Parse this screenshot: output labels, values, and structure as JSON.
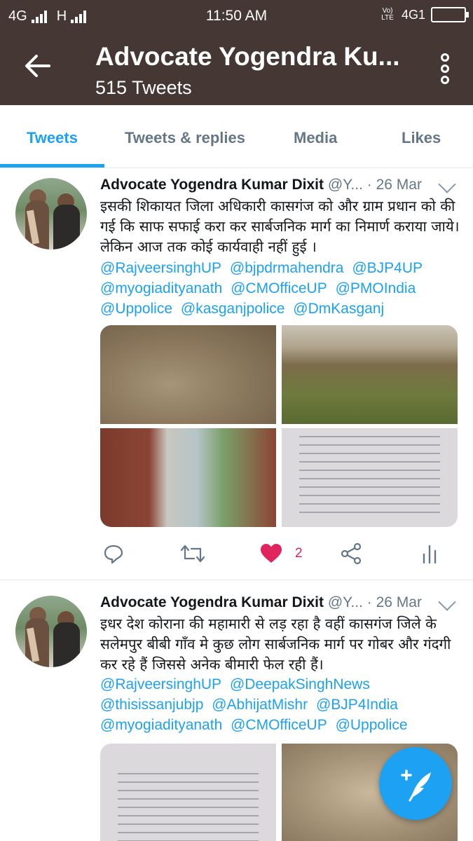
{
  "status_bar": {
    "network_left": "4G",
    "network_h": "H",
    "time": "11:50 AM",
    "volte": "Vo) LTE",
    "network_right": "4G1"
  },
  "app_bar": {
    "title": "Advocate Yogendra Ku...",
    "subtitle": "515 Tweets"
  },
  "tabs": [
    {
      "label": "Tweets",
      "active": true
    },
    {
      "label": "Tweets & replies",
      "active": false
    },
    {
      "label": "Media",
      "active": false
    },
    {
      "label": "Likes",
      "active": false
    }
  ],
  "tweets": [
    {
      "name": "Advocate Yogendra Kumar Dixit",
      "handle": "@Y...",
      "date": "· 26 Mar",
      "text": "इसकी शिकायत जिला अधिकारी कासगंज को और ग्राम प्रधान को की गई कि साफ सफाई करा कर सार्बजनिक मार्ग का निमार्ण कराया जाये। लेकिन आज तक कोई कार्यवाही नहीं हुई ।",
      "mentions": [
        "@RajveersinghUP",
        "@bjpdrmahendra",
        "@BJP4UP",
        "@myogiadityanath",
        "@CMOfficeUP",
        "@PMOIndia",
        "@Uppolice",
        "@kasganjpolice",
        "@DmKasganj"
      ],
      "likes": "2"
    },
    {
      "name": "Advocate Yogendra Kumar Dixit",
      "handle": "@Y...",
      "date": "· 26 Mar",
      "text": "इधर देश कोराना की महामारी से लड़ रहा है वहीं कासगंज जिले के सलेमपुर बीबी गाँव मे कुछ लोग सार्बजनिक मार्ग पर गोबर और गंदगी कर रहे हैं जिससे अनेक बीमारी फेल रही हैं।",
      "mentions": [
        "@RajveersinghUP",
        "@DeepakSinghNews",
        "@thisissanjubjp",
        "@AbhijatMishr",
        "@BJP4India",
        "@myogiadityanath",
        "@CMOfficeUP",
        "@Uppolice"
      ]
    }
  ],
  "colors": {
    "header_bg": "#453733",
    "accent": "#1da1f2",
    "like_red": "#e0245e",
    "muted": "#657786"
  }
}
